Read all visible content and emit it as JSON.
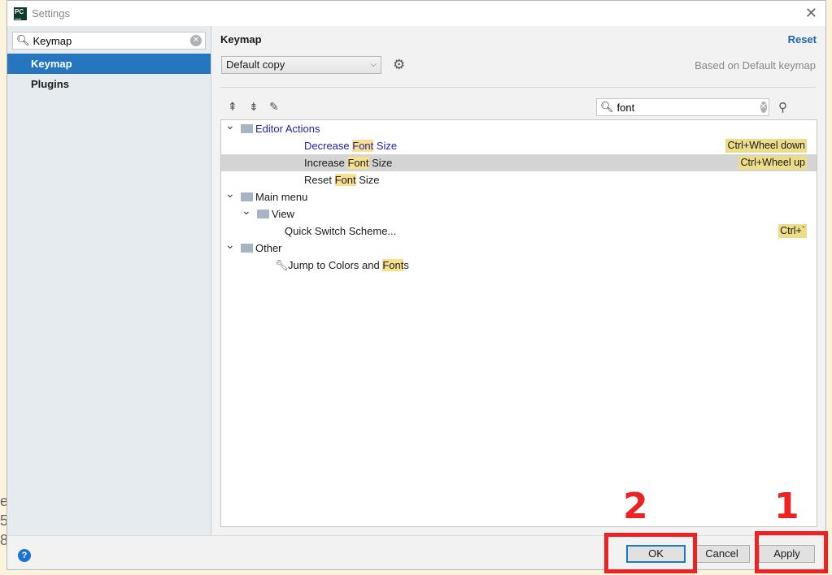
{
  "window": {
    "title": "Settings",
    "logo": "PC"
  },
  "sidebar": {
    "search_value": "Keymap",
    "items": [
      {
        "label": "Keymap",
        "selected": true
      },
      {
        "label": "Plugins",
        "selected": false
      }
    ]
  },
  "main": {
    "heading": "Keymap",
    "reset": "Reset",
    "keymap_select": "Default copy",
    "based_on": "Based on Default keymap",
    "filter_value": "font"
  },
  "tree": [
    {
      "level": 0,
      "expanded": true,
      "icon": "editor-folder-icon",
      "parts": [
        "Editor Actions"
      ],
      "blue": true
    },
    {
      "level": 2,
      "parts": [
        "Decrease ",
        "Font",
        " Size"
      ],
      "blue": true,
      "shortcut": "Ctrl+Wheel down"
    },
    {
      "level": 2,
      "parts": [
        "Increase ",
        "Font",
        " Size"
      ],
      "selected": true,
      "shortcut": "Ctrl+Wheel up"
    },
    {
      "level": 2,
      "parts": [
        "Reset ",
        "Font",
        " Size"
      ]
    },
    {
      "level": 0,
      "expanded": true,
      "icon": "menu-folder-icon",
      "parts": [
        "Main menu"
      ]
    },
    {
      "level": 1,
      "expanded": true,
      "icon": "folder-icon",
      "parts": [
        "View"
      ]
    },
    {
      "level": 3,
      "parts": [
        "Quick Switch Scheme..."
      ],
      "shortcut": "Ctrl+`"
    },
    {
      "level": 0,
      "expanded": true,
      "icon": "other-folder-icon",
      "parts": [
        "Other"
      ]
    },
    {
      "level": 1,
      "icon": "wrench-icon",
      "parts": [
        "Jump to Colors and ",
        "Font",
        "s"
      ]
    }
  ],
  "buttons": {
    "ok": "OK",
    "cancel": "Cancel",
    "apply": "Apply"
  },
  "annotations": {
    "first": "1",
    "second": "2",
    "color": "#ee2222"
  },
  "colors": {
    "accent": "#2675bf",
    "highlight": "#f8e08e"
  }
}
